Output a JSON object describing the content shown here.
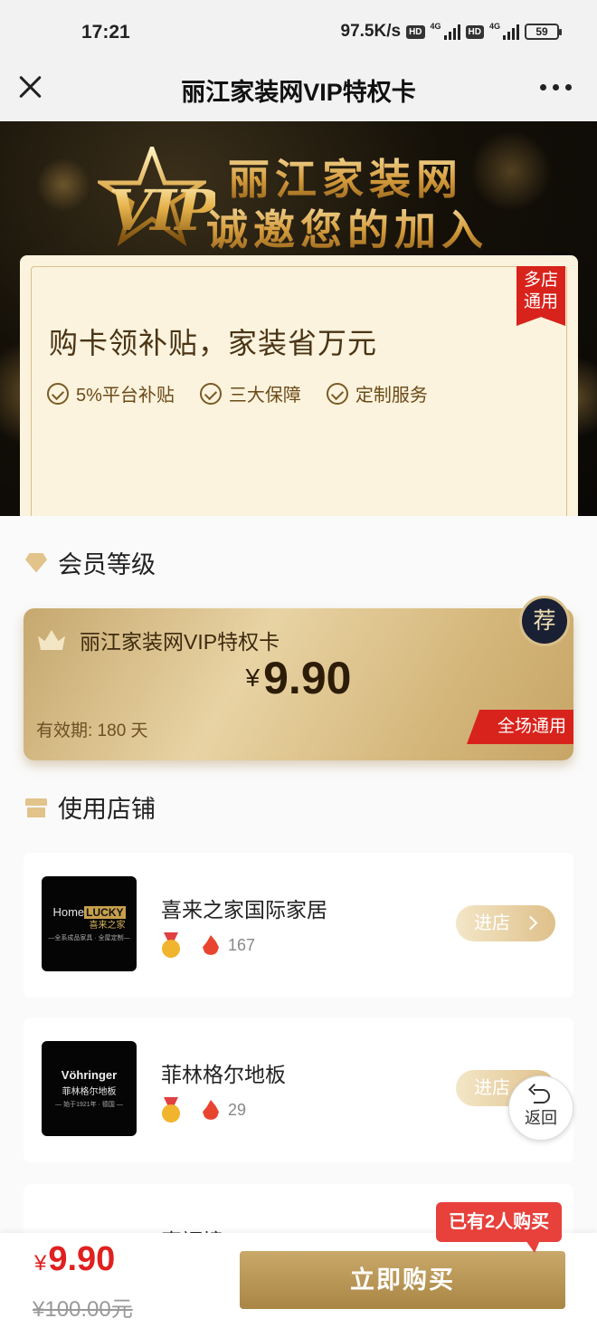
{
  "status_bar": {
    "time": "17:21",
    "speed": "97.5K/s",
    "hd1": "HD",
    "net1": "4G",
    "hd2": "HD",
    "net2": "4G",
    "battery": "59"
  },
  "nav": {
    "title": "丽江家装网VIP特权卡"
  },
  "hero": {
    "badge": "VIP",
    "line1": "丽江家装网",
    "line2": "诚邀您的加入",
    "card": {
      "ribbon": "多店通用",
      "headline": "购卡领补贴，家装省万元",
      "features": [
        "5%平台补贴",
        "三大保障",
        "定制服务"
      ]
    }
  },
  "membership": {
    "section_title": "会员等级",
    "card_name": "丽江家装网VIP特权卡",
    "currency": "¥",
    "price": "9.90",
    "validity": "有效期:  180 天",
    "scope": "全场通用",
    "recommend": "荐"
  },
  "stores": {
    "section_title": "使用店铺",
    "items": [
      {
        "name": "喜来之家国际家居",
        "heat": "167",
        "enter": "进店",
        "logo": {
          "line1": "Home",
          "line1_tag": "LUCKY",
          "line1_cn": "喜来之家",
          "line2": "—全系成品家具 · 全屋定制—"
        }
      },
      {
        "name": "菲林格尔地板",
        "heat": "29",
        "enter": "进店",
        "logo": {
          "line1": "Vöhringer",
          "line1_tag": "",
          "line1_cn": "菲林格尔地板",
          "line2": "— 始于1921年 · 德国 —"
        }
      },
      {
        "name": "喜福境"
      }
    ]
  },
  "float": {
    "back_label": "返回"
  },
  "bottom_bar": {
    "currency": "¥",
    "price": "9.90",
    "original_price": "¥100.00元",
    "buy_label": "立即购买",
    "bought_bubble": "已有2人购买"
  }
}
